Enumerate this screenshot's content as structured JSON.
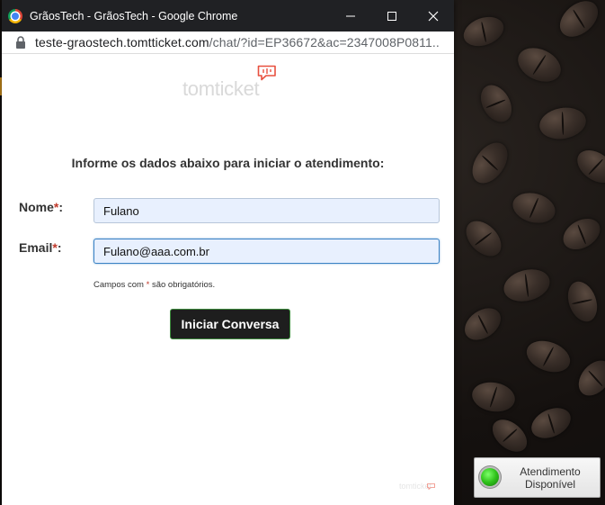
{
  "window": {
    "title": "GrãosTech - GrãosTech - Google Chrome",
    "url_host": "teste-graostech.tomtticket.com",
    "url_path": "/chat/?id=EP36672&ac=2347008P0811..."
  },
  "logo": {
    "text": "tomticket"
  },
  "form": {
    "heading": "Informe os dados abaixo para iniciar o atendimento:",
    "name_label": "Nome",
    "email_label": "Email",
    "required_mark": "*",
    "label_colon": ":",
    "name_value": "Fulano",
    "email_value": "Fulano@aaa.com.br",
    "note_prefix": "Campos com ",
    "note_suffix": " são obrigatórios.",
    "submit_label": "Iniciar Conversa"
  },
  "footer": {
    "logo_text": "tomticket"
  },
  "widget": {
    "line1": "Atendimento",
    "line2": "Disponível",
    "status_color": "#2fc21a"
  },
  "colors": {
    "titlebar": "#202124",
    "required": "#c0392b",
    "button_bg": "#1e1e1e",
    "field_bg": "#e8f0fe"
  }
}
